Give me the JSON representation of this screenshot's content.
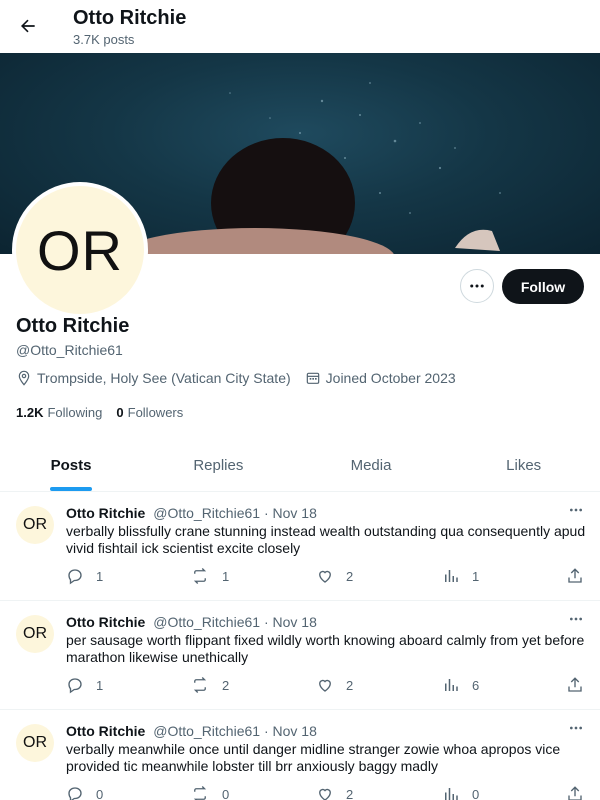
{
  "header": {
    "title": "Otto Ritchie",
    "posts_count": "3.7K posts"
  },
  "profile": {
    "avatar_initials": "OR",
    "name": "Otto Ritchie",
    "handle": "@Otto_Ritchie61",
    "location": "Trompside, Holy See (Vatican City State)",
    "joined": "Joined October 2023",
    "following_count": "1.2K",
    "following_label": "Following",
    "followers_count": "0",
    "followers_label": "Followers",
    "follow_label": "Follow"
  },
  "tabs": [
    {
      "label": "Posts",
      "active": true
    },
    {
      "label": "Replies",
      "active": false
    },
    {
      "label": "Media",
      "active": false
    },
    {
      "label": "Likes",
      "active": false
    }
  ],
  "posts": [
    {
      "avatar": "OR",
      "name": "Otto Ritchie",
      "handle": "@Otto_Ritchie61",
      "date": "· Nov 18",
      "text": "verbally blissfully crane stunning instead wealth outstanding qua consequently apud vivid fishtail ick scientist excite closely",
      "replies": "1",
      "reposts": "1",
      "likes": "2",
      "views": "1"
    },
    {
      "avatar": "OR",
      "name": "Otto Ritchie",
      "handle": "@Otto_Ritchie61",
      "date": "· Nov 18",
      "text": "per sausage worth flippant fixed wildly worth knowing aboard calmly from yet before marathon likewise unethically",
      "replies": "1",
      "reposts": "2",
      "likes": "2",
      "views": "6"
    },
    {
      "avatar": "OR",
      "name": "Otto Ritchie",
      "handle": "@Otto_Ritchie61",
      "date": "· Nov 18",
      "text": "verbally meanwhile once until danger midline stranger zowie whoa apropos vice provided tic meanwhile lobster till brr anxiously baggy madly",
      "replies": "0",
      "reposts": "0",
      "likes": "2",
      "views": "0"
    }
  ],
  "icons": {
    "back": "arrow-left-icon",
    "more": "ellipsis-icon",
    "location": "location-pin-icon",
    "calendar": "calendar-icon",
    "reply": "reply-icon",
    "repost": "repost-icon",
    "like": "heart-icon",
    "views": "views-icon",
    "share": "share-icon"
  },
  "colors": {
    "accent": "#1d9bf0",
    "text": "#0f1419",
    "muted": "#536471",
    "avatar_bg": "#fdf6dc",
    "follow_bg": "#0f1419"
  }
}
